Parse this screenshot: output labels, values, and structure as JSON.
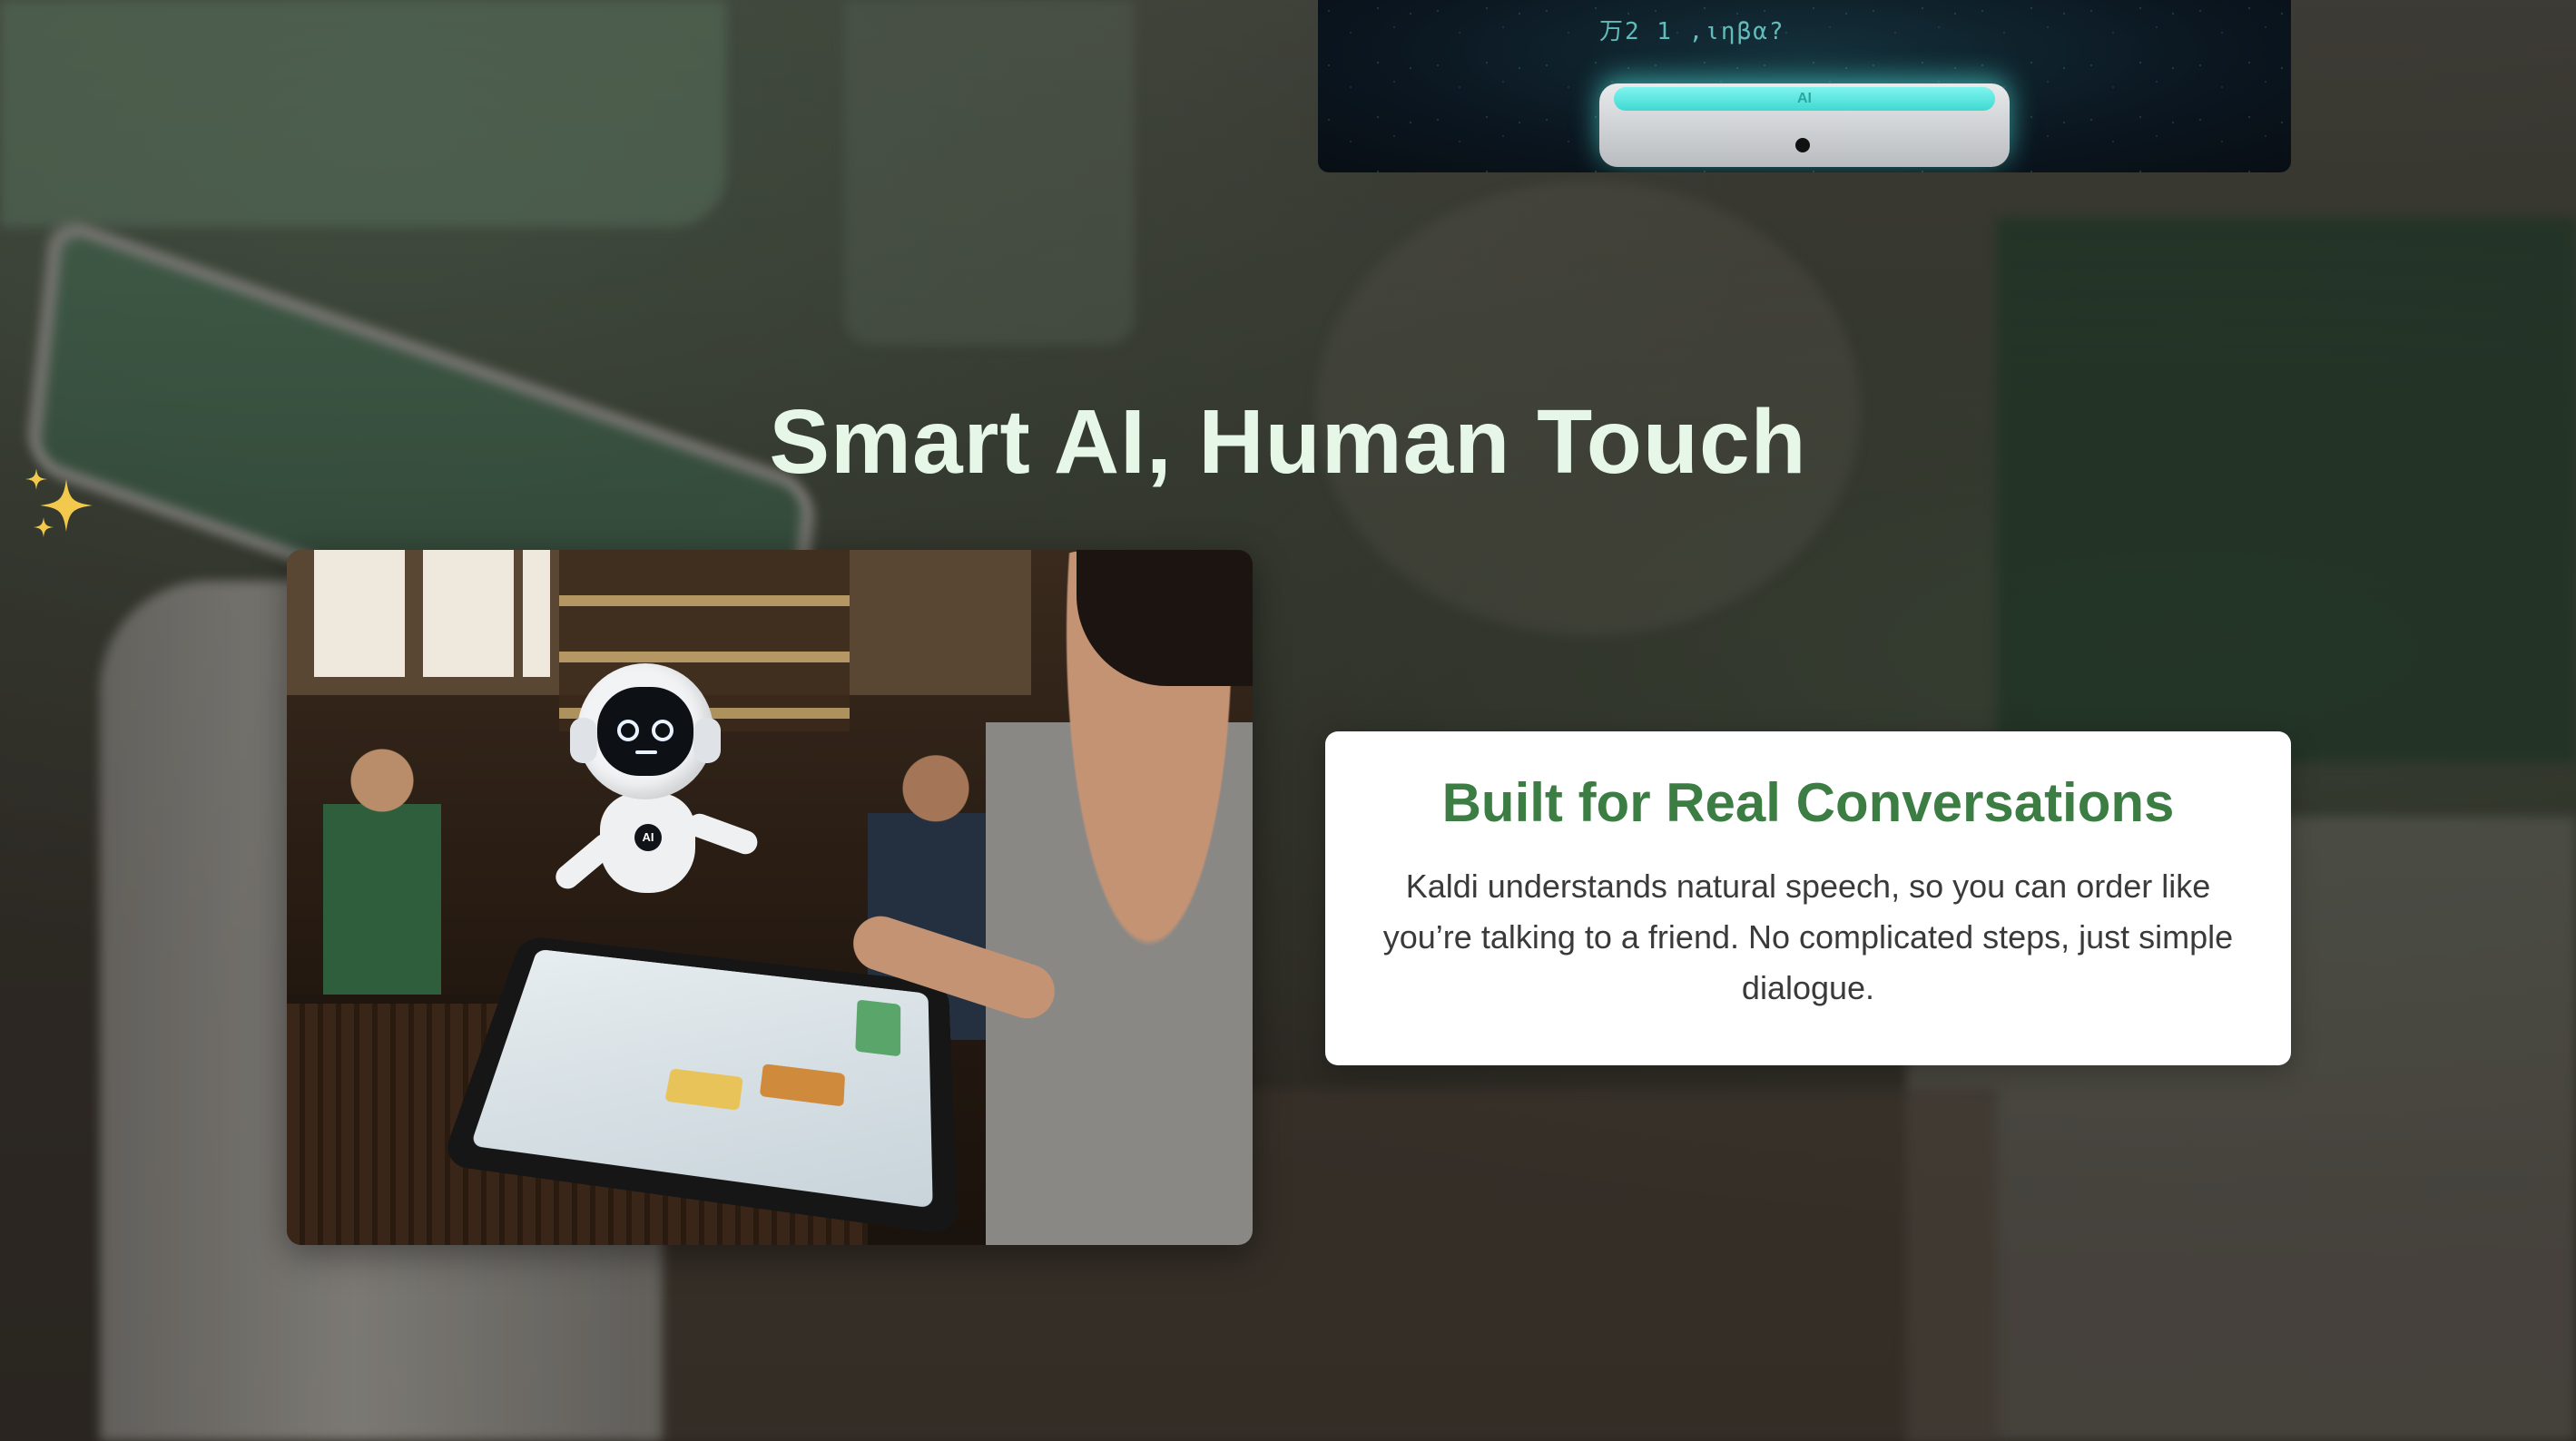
{
  "hero": {
    "title": "Smart AI, Human Touch"
  },
  "top_image": {
    "glyph_text": "万2 1 ,ιηβα?",
    "pad_label": "AI"
  },
  "photo": {
    "robot_badge": "AI"
  },
  "feature_card": {
    "title": "Built for Real Conversations",
    "body": "Kaldi understands natural speech, so you can order like you’re talking to a friend. No complicated steps, just simple dialogue."
  },
  "decorations": {
    "sparkle_icon": "sparkles-icon",
    "sparkle_color": "#f2c94c"
  },
  "colors": {
    "title_color": "#e6f7e7",
    "card_title_color": "#3c7d44",
    "card_background": "#ffffff"
  }
}
